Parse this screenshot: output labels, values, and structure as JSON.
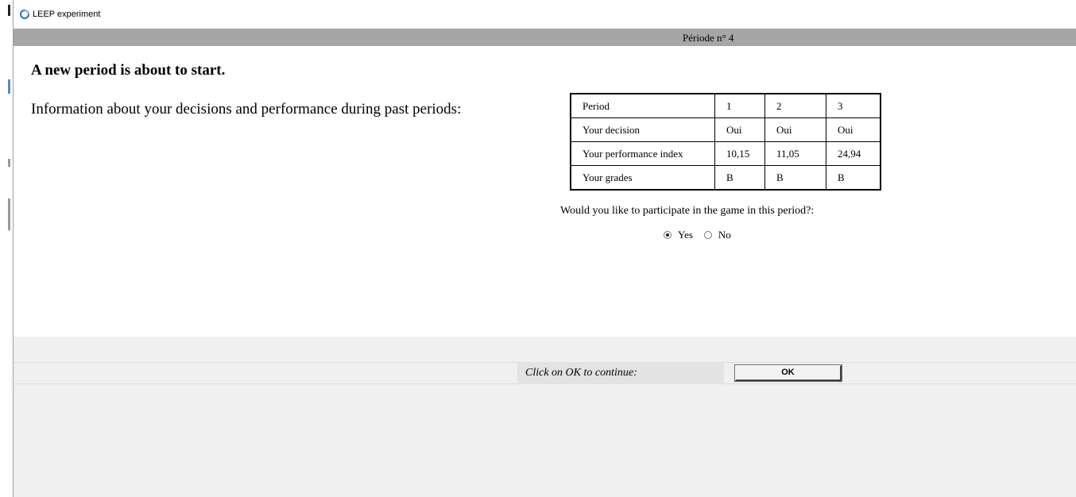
{
  "window": {
    "title": "LEEP experiment"
  },
  "header": {
    "period_label": "Période n° 4"
  },
  "main": {
    "headline": "A new period is about to start.",
    "info_text": "Information about your decisions and performance during past periods:",
    "table": {
      "rows": [
        [
          "Period",
          "1",
          "2",
          "3"
        ],
        [
          "Your decision",
          "Oui",
          "Oui",
          "Oui"
        ],
        [
          "Your performance index",
          "10,15",
          "11,05",
          "24,94"
        ],
        [
          "Your grades",
          "B",
          "B",
          "B"
        ]
      ]
    },
    "question": "Would you like to participate in the game in this period?:",
    "options": {
      "yes": "Yes",
      "no": "No",
      "selected": "Yes"
    }
  },
  "footer": {
    "continue_text": "Click on OK to continue:",
    "ok_label": "OK"
  },
  "colors": {
    "period_bar": "#a6a6a6",
    "footer_bg": "#f0f0f0"
  }
}
